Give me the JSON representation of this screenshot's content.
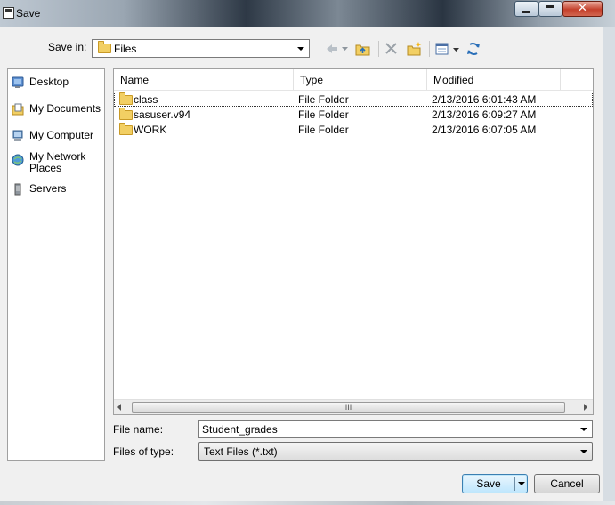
{
  "window": {
    "title": "Save",
    "controls": {
      "minimize": "minimize-icon",
      "maximize": "maximize-icon",
      "close": "close-icon",
      "close_glyph": "✕"
    }
  },
  "toolbar": {
    "save_in_label": "Save in:",
    "save_in_value": "Files",
    "buttons": [
      "back-arrow-icon",
      "dropdown-icon",
      "up-folder-icon",
      "delete-icon",
      "new-folder-icon",
      "views-menu-icon",
      "refresh-icon"
    ]
  },
  "places": [
    {
      "label": "Desktop",
      "icon": "desktop-icon"
    },
    {
      "label": "My Documents",
      "icon": "documents-icon"
    },
    {
      "label": "My Computer",
      "icon": "computer-icon"
    },
    {
      "label": "My Network Places",
      "icon": "network-icon"
    },
    {
      "label": "Servers",
      "icon": "server-icon"
    }
  ],
  "file_list": {
    "columns": [
      "Name",
      "Type",
      "Modified"
    ],
    "rows": [
      {
        "name": "class",
        "type": "File Folder",
        "modified": "2/13/2016 6:01:43 AM"
      },
      {
        "name": "sasuser.v94",
        "type": "File Folder",
        "modified": "2/13/2016 6:09:27 AM"
      },
      {
        "name": "WORK",
        "type": "File Folder",
        "modified": "2/13/2016 6:07:05 AM"
      }
    ],
    "scrollbar_grip": "III"
  },
  "form": {
    "file_name_label": "File name:",
    "file_name_value": "Student_grades",
    "file_type_label": "Files of type:",
    "file_type_value": "Text Files (*.txt)"
  },
  "buttons": {
    "save": "Save",
    "cancel": "Cancel"
  },
  "colors": {
    "accent": "#3c7fb1",
    "folder": "#f2cf63",
    "dialog_bg": "#f0f0f0"
  }
}
